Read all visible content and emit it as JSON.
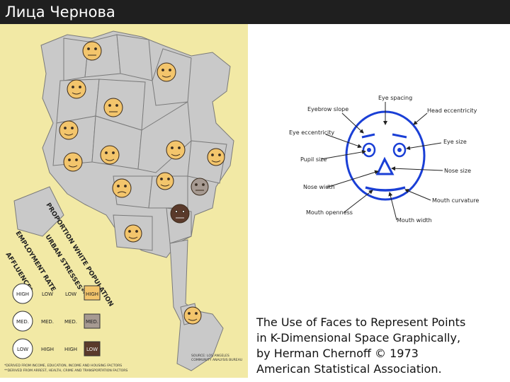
{
  "slide": {
    "title": "Лица Чернова",
    "caption_lines": [
      "The Use of Faces to Represent Points",
      "in K-Dimensional Space Graphically,",
      "by Herman Chernoff © 1973",
      "American Statistical Association."
    ]
  },
  "map": {
    "rotated_labels": [
      "PROPORTION WHITE POPULATION",
      "URBAN STRESSES**",
      "EMPLOYMENT RATE",
      "AFFLUENCE*"
    ],
    "legend": {
      "rows": [
        {
          "face": "HIGH",
          "mouth": "LOW",
          "eyes": "LOW",
          "color": "HIGH"
        },
        {
          "face": "MED.",
          "mouth": "MED.",
          "eyes": "MED.",
          "color": "MED."
        },
        {
          "face": "LOW",
          "mouth": "HIGH",
          "eyes": "HIGH",
          "color": "LOW"
        }
      ]
    },
    "footnotes": [
      "*DERIVED FROM INCOME, EDUCATION, INCOME AND HOUSING FACTORS",
      "**DERIVED FROM ARREST, HEALTH, CRIME AND TRANSPORTATION FACTORS"
    ],
    "source_lines": [
      "SOURCE: LOS ANGELES",
      "COMMUNITY ANALYSIS BUREAU"
    ],
    "colors": {
      "land": "#f2e9a5",
      "region": "#c8c8c8",
      "high": "#f3c56c",
      "med": "#a69a92",
      "low": "#5a3a2b"
    }
  },
  "diagram": {
    "labels": {
      "eye_spacing": "Eye spacing",
      "eyebrow_slope": "Eyebrow slope",
      "head_eccentricity": "Head eccentricity",
      "eye_eccentricity": "Eye eccentricity",
      "eye_size": "Eye size",
      "pupil_size": "Pupil size",
      "nose_size": "Nose size",
      "nose_width": "Nose width",
      "mouth_curvature": "Mouth curvature",
      "mouth_openness": "Mouth openness",
      "mouth_width": "Mouth width"
    },
    "colors": {
      "face": "#1a3fd6",
      "arrow": "#222222"
    }
  }
}
